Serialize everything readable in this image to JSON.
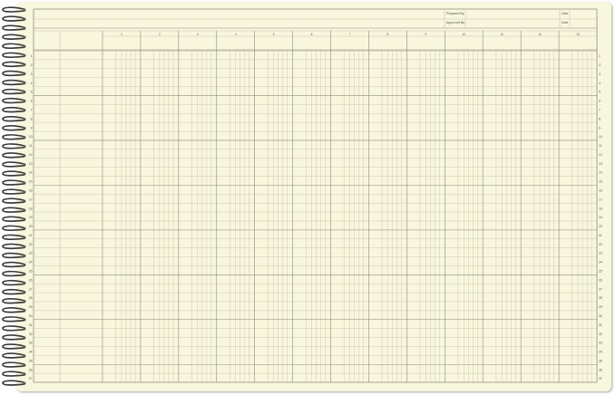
{
  "header": {
    "prepared_by_label": "Prepared By",
    "approved_by_label": "Approved By",
    "date_label_1": "Date",
    "date_label_2": "Date"
  },
  "columns": [
    "1",
    "2",
    "3",
    "4",
    "5",
    "6",
    "7",
    "8",
    "9",
    "10",
    "11",
    "12",
    "13"
  ],
  "rows": [
    "1",
    "2",
    "3",
    "4",
    "5",
    "6",
    "7",
    "8",
    "9",
    "10",
    "11",
    "12",
    "13",
    "14",
    "15",
    "16",
    "17",
    "18",
    "19",
    "20",
    "21",
    "22",
    "23",
    "24",
    "25",
    "26",
    "27",
    "28",
    "29",
    "30",
    "31",
    "32",
    "33",
    "34",
    "35",
    "36",
    "37"
  ],
  "colors": {
    "paper": "#f8f6dc",
    "grid": "#b9b8a6",
    "grid_dark": "#8d8c7c",
    "ring": "#3a3a3a"
  }
}
